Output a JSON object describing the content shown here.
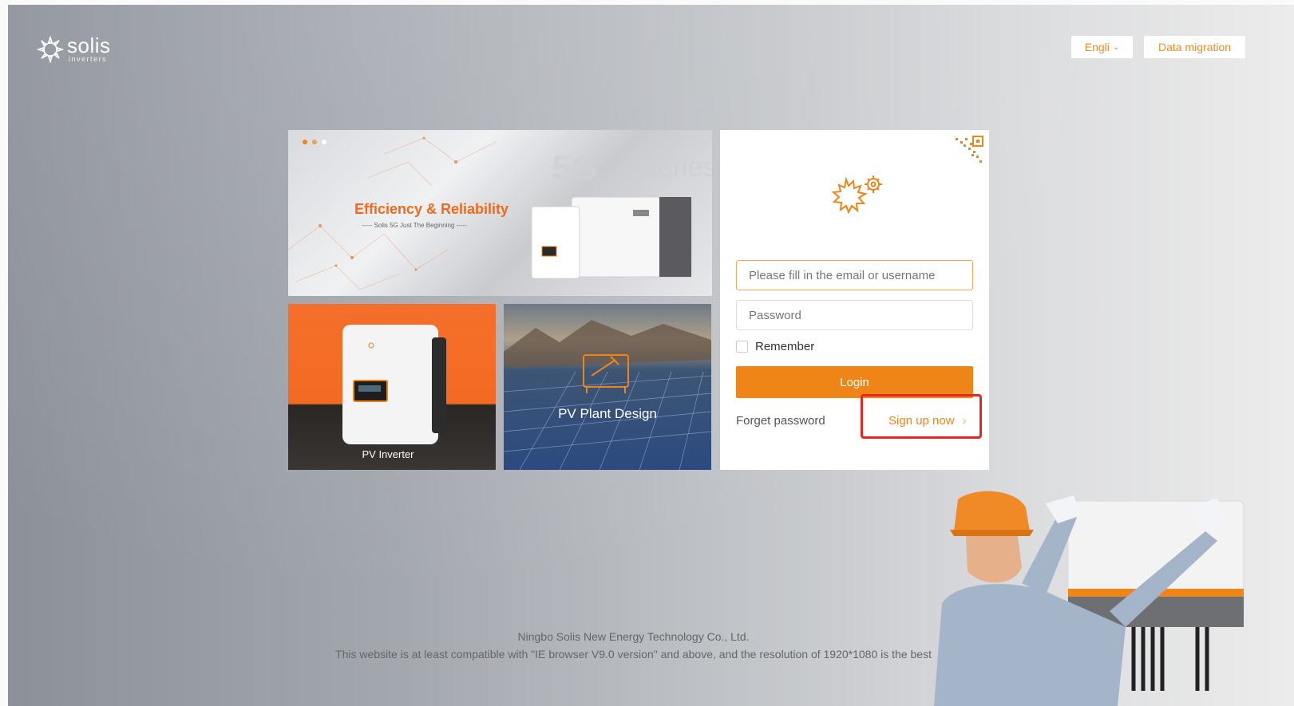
{
  "brand": {
    "name": "solis",
    "subtitle": "inverters"
  },
  "header": {
    "language_label": "Engli",
    "data_migration_label": "Data migration"
  },
  "banner": {
    "headline": "Efficiency & Reliability",
    "tagline": "----- Solis 5G Just The Beginning -----",
    "series_text": "5G Series"
  },
  "tiles": [
    {
      "label": "PV Inverter"
    },
    {
      "label": "PV Plant Design"
    }
  ],
  "login": {
    "username_placeholder": "Please fill in the email or username",
    "password_placeholder": "Password",
    "remember_label": "Remember",
    "login_button": "Login",
    "forget_password": "Forget password",
    "sign_up": "Sign up now",
    "sign_up_chevron": "›"
  },
  "footer": {
    "company": "Ningbo Solis New Energy Technology Co., Ltd.",
    "compat_note": "This website is at least compatible with \"IE browser V9.0 version\" and above, and the resolution of 1920*1080 is the best"
  },
  "colors": {
    "accent": "#ef8417",
    "highlight": "#e8261f"
  }
}
